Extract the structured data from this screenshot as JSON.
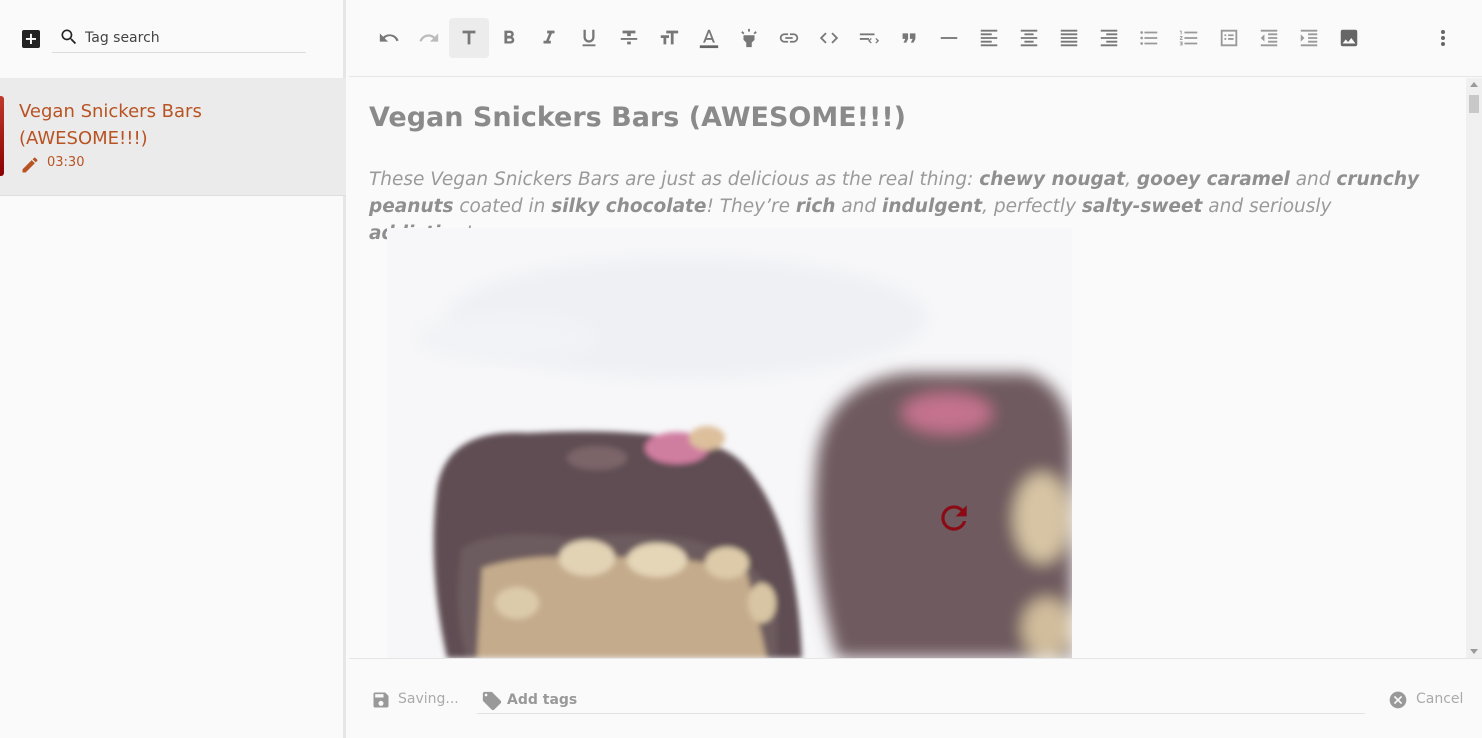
{
  "sidebar": {
    "search_placeholder": "Tag search",
    "notes": [
      {
        "title": "Vegan Snickers Bars (AWESOME!!!)",
        "time": "03:30"
      }
    ]
  },
  "toolbar": {
    "buttons": [
      "undo",
      "redo",
      "text-style",
      "bold",
      "italic",
      "underline",
      "strikethrough",
      "font-size",
      "text-color",
      "highlight",
      "link",
      "code",
      "clear-format",
      "blockquote",
      "horizontal-rule",
      "align-left",
      "align-center",
      "align-justify",
      "align-right",
      "bulleted-list",
      "numbered-list",
      "checklist",
      "outdent",
      "indent",
      "insert-image",
      "more-options"
    ],
    "active": "text-style"
  },
  "editor": {
    "title": "Vegan Snickers Bars (AWESOME!!!)",
    "intro": {
      "s1": "These Vegan Snickers Bars are just as delicious as the real thing: ",
      "b1": "chewy nougat",
      "s2": ", ",
      "b2": "gooey caramel",
      "s3": " and ",
      "b3": "crunchy peanuts",
      "s4": " coated in ",
      "b4": "silky chocolate",
      "s5": "! They’re ",
      "b5": "rich",
      "s6": " and ",
      "b6": "indulgent",
      "s7": ", perfectly ",
      "b7": "salty-sweet",
      "s8": " and seriously ",
      "b8": "addictive",
      "s9": "!"
    }
  },
  "footer": {
    "save_status": "Saving...",
    "tags_placeholder": "Add tags",
    "cancel_label": "Cancel"
  },
  "colors": {
    "accent": "#b85323",
    "reload": "#8b0a14",
    "toolbar_icon": "#777777"
  }
}
